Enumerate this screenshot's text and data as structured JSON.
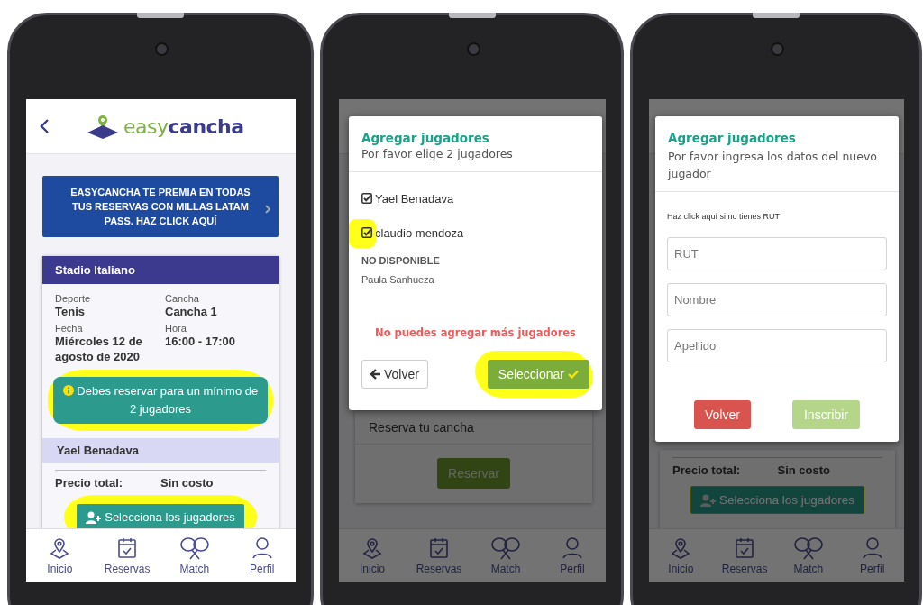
{
  "booking_screen": {
    "logo": {
      "prefix": "easy",
      "suffix": "cancha"
    },
    "banner": "EASYCANCHA TE PREMIA EN TODAS TUS RESERVAS CON MILLAS LATAM PASS. HAZ CLICK AQUÍ",
    "venue": "Stadio Italiano",
    "details": [
      {
        "label": "Deporte",
        "value": "Tenis"
      },
      {
        "label": "Cancha",
        "value": "Cancha 1"
      },
      {
        "label": "Fecha",
        "value": "Miércoles 12 de agosto de 2020"
      },
      {
        "label": "Hora",
        "value": "16:00 - 17:00"
      }
    ],
    "notice": {
      "text": "Debes reservar para un mínimo de 2 jugadores",
      "highlighted": true
    },
    "player": "Yael Benadava",
    "price_label": "Precio total:",
    "price_value": "Sin costo",
    "select_button": {
      "label": "Selecciona los jugadores",
      "highlighted": true
    },
    "nav_items": [
      {
        "label": "Inicio",
        "kind": "home"
      },
      {
        "label": "Reservas",
        "kind": "bookings"
      },
      {
        "label": "Match",
        "kind": "match"
      },
      {
        "label": "Perfil",
        "kind": "profile"
      }
    ]
  },
  "select_players_screen": {
    "card_title": "Reserva tu cancha",
    "reserve_button": "Reservar",
    "modal": {
      "title": "Agregar jugadores",
      "subtitle": "Por favor elige 2 jugadores",
      "players": [
        {
          "name": "Yael Benadava",
          "checked": true,
          "highlighted": false
        },
        {
          "name": "claudio mendoza",
          "checked": true,
          "highlighted": true
        }
      ],
      "unavailable_heading": "NO DISPONIBLE",
      "unavailable_players": [
        "Paula Sanhueza"
      ],
      "error": "No puedes agregar más jugadores",
      "back_button": "Volver",
      "confirm_button": {
        "label": "Seleccionar",
        "highlighted": true
      }
    },
    "nav_items": [
      {
        "label": "Inicio",
        "kind": "home"
      },
      {
        "label": "Reservas",
        "kind": "bookings"
      },
      {
        "label": "Match",
        "kind": "match"
      },
      {
        "label": "Perfil",
        "kind": "profile"
      }
    ]
  },
  "new_player_screen": {
    "price_label": "Precio total:",
    "price_value": "Sin costo",
    "select_button": "Selecciona los jugadores",
    "modal": {
      "title": "Agregar jugadores",
      "subtitle": "Por favor ingresa los datos del nuevo jugador",
      "no_rut_link": "Haz click aquí si no tienes RUT",
      "fields": [
        {
          "placeholder": "RUT"
        },
        {
          "placeholder": "Nombre"
        },
        {
          "placeholder": "Apellido"
        }
      ],
      "back_button": "Volver",
      "submit_button": {
        "label": "Inscribir",
        "disabled": true
      }
    },
    "nav_items": [
      {
        "label": "Inicio",
        "kind": "home"
      },
      {
        "label": "Reservas",
        "kind": "bookings"
      },
      {
        "label": "Match",
        "kind": "match"
      },
      {
        "label": "Perfil",
        "kind": "profile"
      }
    ]
  }
}
